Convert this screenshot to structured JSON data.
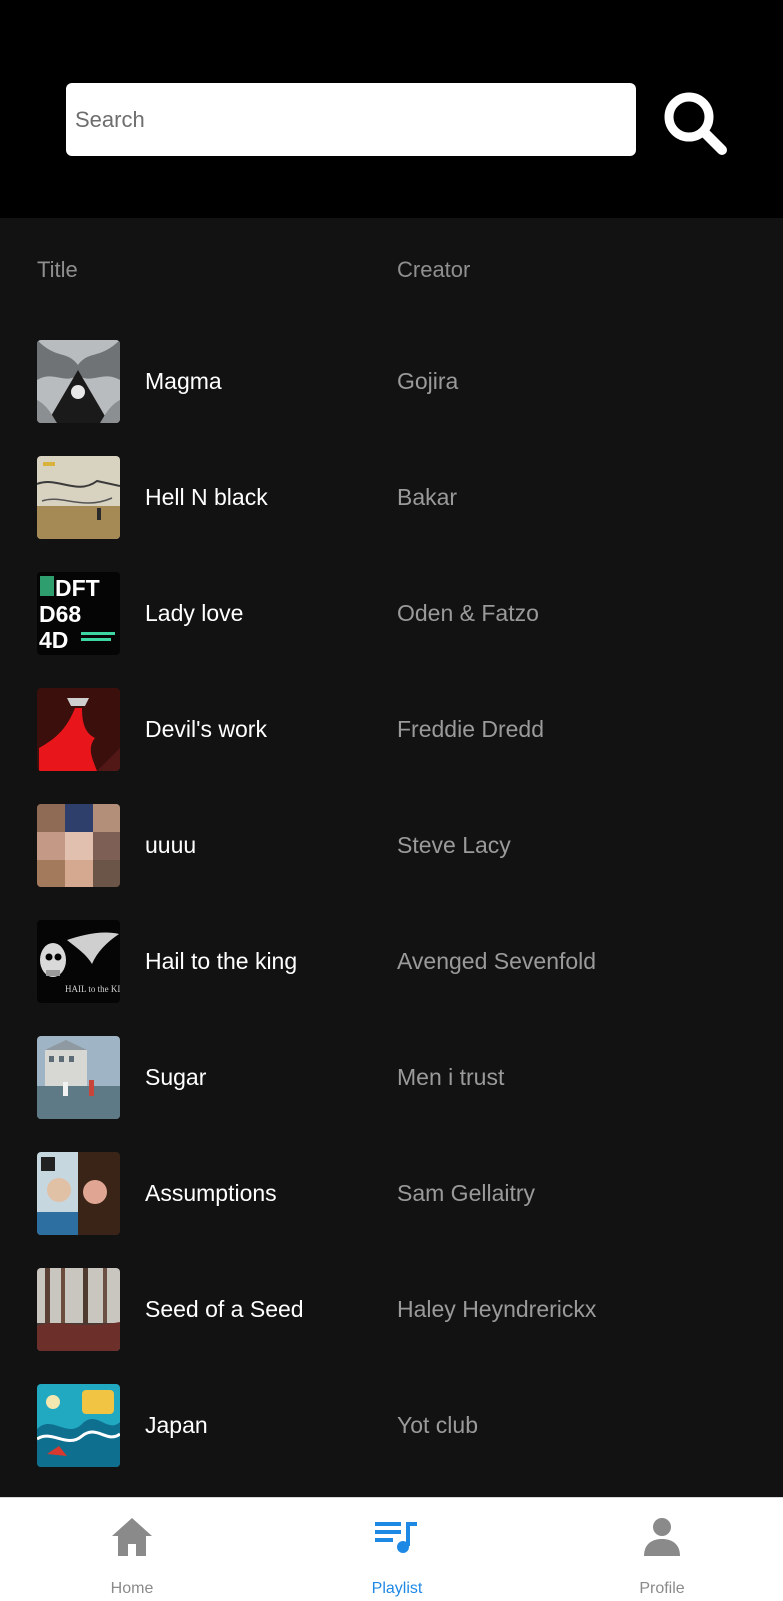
{
  "search": {
    "placeholder": "Search",
    "button_icon": "search-icon"
  },
  "columns": {
    "title": "Title",
    "creator": "Creator"
  },
  "tracks": [
    {
      "title": "Magma",
      "creator": "Gojira"
    },
    {
      "title": "Hell N black",
      "creator": "Bakar"
    },
    {
      "title": "Lady love",
      "creator": "Oden & Fatzo"
    },
    {
      "title": "Devil's work",
      "creator": "Freddie Dredd"
    },
    {
      "title": "uuuu",
      "creator": "Steve Lacy"
    },
    {
      "title": "Hail to the king",
      "creator": "Avenged Sevenfold"
    },
    {
      "title": "Sugar",
      "creator": "Men i trust"
    },
    {
      "title": "Assumptions",
      "creator": "Sam Gellaitry"
    },
    {
      "title": "Seed of a Seed",
      "creator": "Haley Heyndrerickx"
    },
    {
      "title": "Japan",
      "creator": "Yot club"
    }
  ],
  "album_art_text": {
    "lady_love": [
      "DFT",
      "D68",
      "4D"
    ],
    "hail_to_the_king": "HAIL to the KING"
  },
  "nav": {
    "home": {
      "label": "Home",
      "icon": "home-icon"
    },
    "playlist": {
      "label": "Playlist",
      "icon": "playlist-icon",
      "active": true
    },
    "profile": {
      "label": "Profile",
      "icon": "profile-icon"
    }
  },
  "colors": {
    "top_bar": "#000000",
    "background": "#121212",
    "accent": "#1e88e5",
    "nav_bar": "#ffffff"
  }
}
